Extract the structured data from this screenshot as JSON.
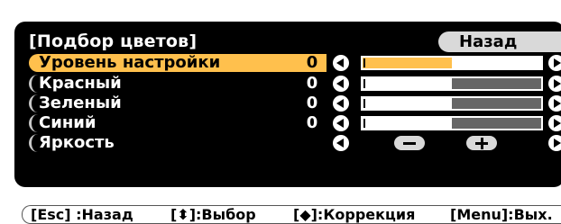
{
  "panel": {
    "title": "[Подбор цветов]",
    "back_label": "Назад",
    "rows": [
      {
        "label": "Уровень настройки",
        "value": "0",
        "level": 0.5,
        "selected": true
      },
      {
        "label": "Красный",
        "value": "0",
        "level": 0.5
      },
      {
        "label": "Зеленый",
        "value": "0",
        "level": 0.5
      },
      {
        "label": "Синий",
        "value": "0",
        "level": 0.5
      },
      {
        "label": "Яркость"
      }
    ]
  },
  "footer": {
    "back": "[Esc] :Назад",
    "select": "[⬍]:Выбор",
    "adjust": "[◆]:Коррекция",
    "exit": "[Menu]:Вых."
  },
  "colors": {
    "panel_background": "#000000",
    "highlight": "#ffc04d",
    "button_background": "#d9d9d9"
  }
}
